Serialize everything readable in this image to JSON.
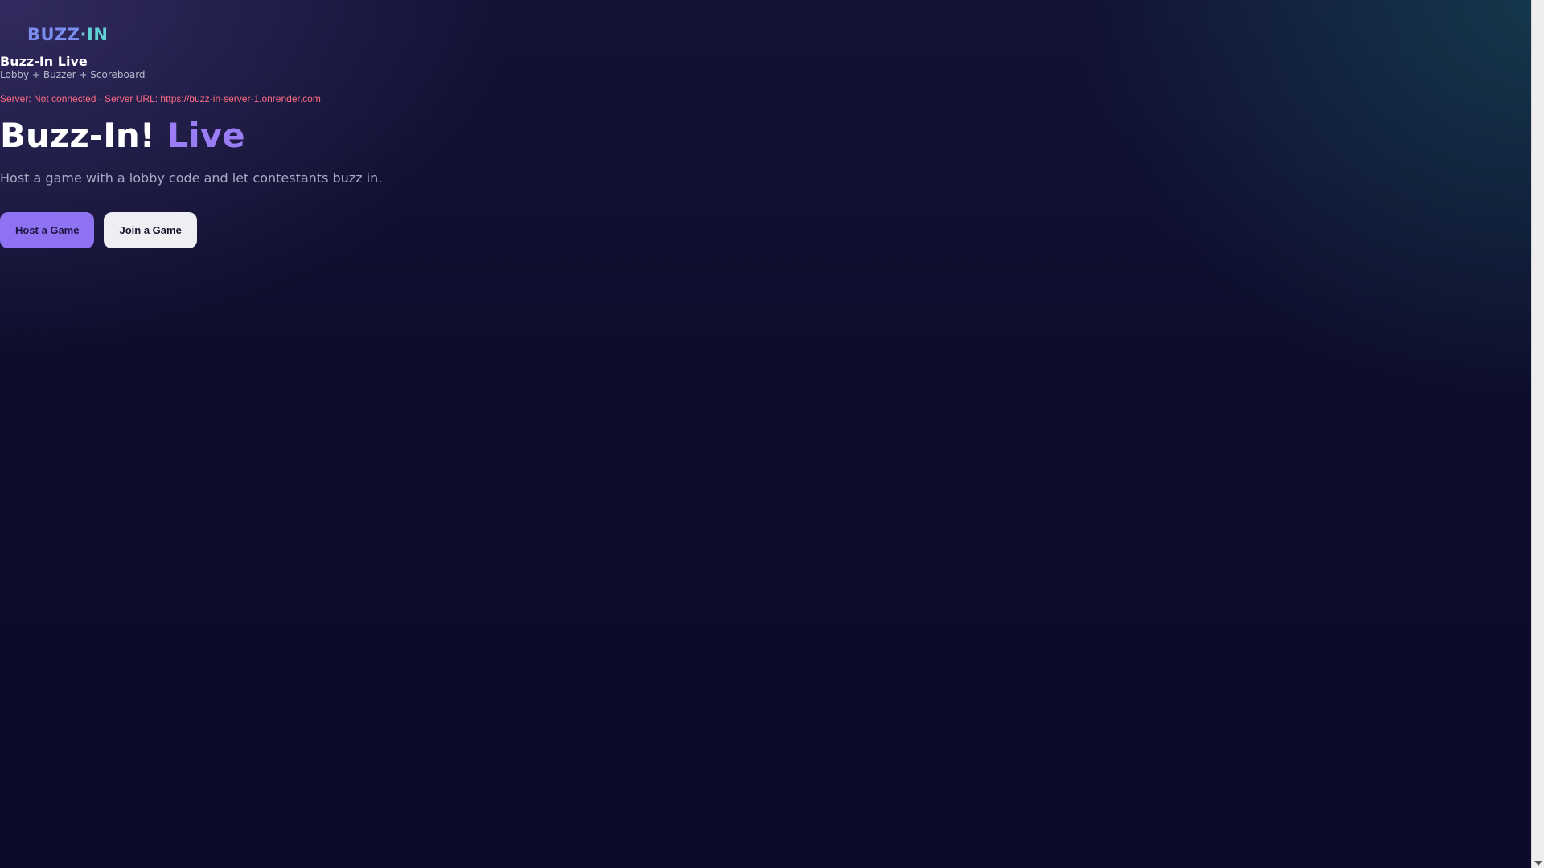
{
  "logo": {
    "part_a": "BUZZ",
    "dot": "·",
    "part_b": "IN"
  },
  "brand": {
    "title": "Buzz-In Live",
    "subtitle": "Lobby + Buzzer + Scoreboard"
  },
  "server": {
    "status_line": "Server: Not connected · Server URL: https://buzz-in-server-1.onrender.com"
  },
  "hero": {
    "title_main": "Buzz-In!",
    "title_accent": "Live",
    "subtitle": "Host a game with a lobby code and let contestants buzz in."
  },
  "actions": {
    "host_label": "Host a Game",
    "join_label": "Join a Game"
  },
  "colors": {
    "background": "#0d0d2b",
    "accent_purple": "#9a7cf5",
    "host_button": "#8f72f2",
    "join_button": "#eeeef3",
    "status_error": "#ff6b81",
    "logo_teal": "#5fd2d6"
  },
  "icons": {
    "scroll_down": "chevron-down-icon"
  }
}
